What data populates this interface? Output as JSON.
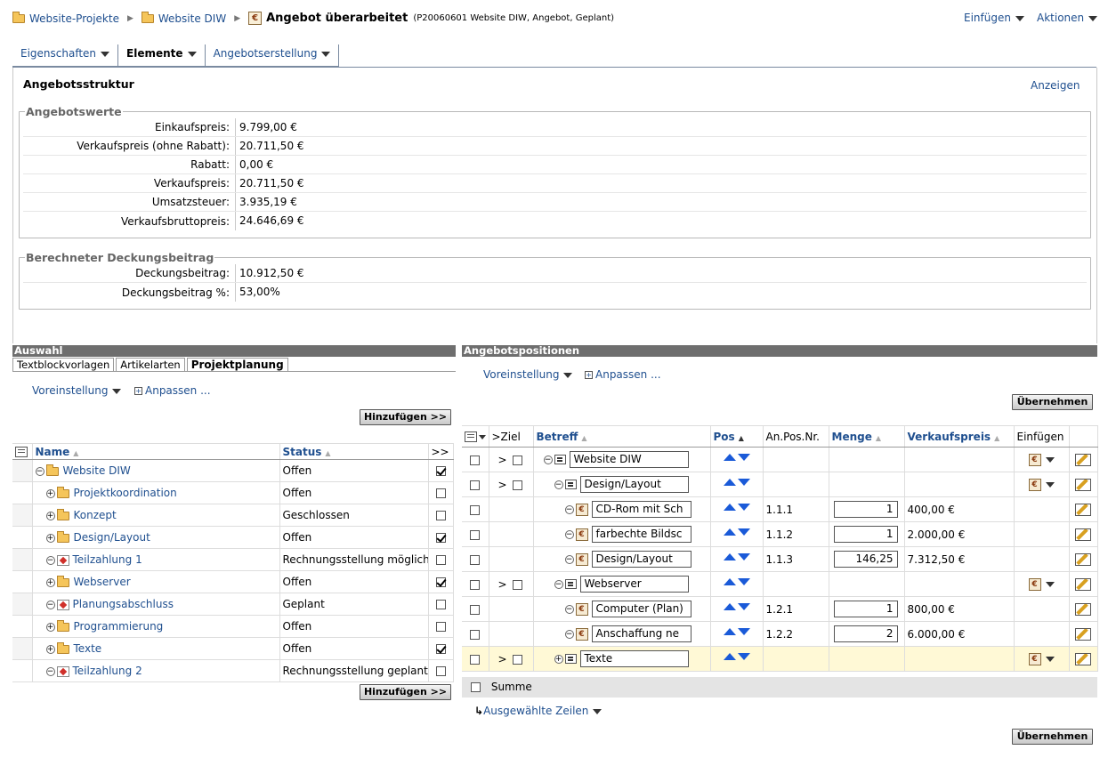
{
  "breadcrumb": {
    "items": [
      "Website-Projekte",
      "Website DIW"
    ],
    "current_title": "Angebot überarbeitet",
    "current_subtitle": "(P20060601 Website DIW, Angebot, Geplant)"
  },
  "top_menu": {
    "insert": "Einfügen",
    "actions": "Aktionen"
  },
  "tabs": [
    {
      "label": "Eigenschaften",
      "active": false
    },
    {
      "label": "Elemente",
      "active": true
    },
    {
      "label": "Angebotserstellung",
      "active": false
    }
  ],
  "structure": {
    "title": "Angebotsstruktur",
    "show_link": "Anzeigen"
  },
  "angebotswerte": {
    "legend": "Angebotswerte",
    "rows": [
      {
        "label": "Einkaufspreis:",
        "value": "9.799,00 €"
      },
      {
        "label": "Verkaufspreis (ohne Rabatt):",
        "value": "20.711,50 €"
      },
      {
        "label": "Rabatt:",
        "value": "0,00 €"
      },
      {
        "label": "Verkaufspreis:",
        "value": "20.711,50 €"
      },
      {
        "label": "Umsatzsteuer:",
        "value": "3.935,19 €"
      },
      {
        "label": "Verkaufsbruttopreis:",
        "value": "24.646,69 €"
      }
    ]
  },
  "deckungsbeitrag": {
    "legend": "Berechneter Deckungsbeitrag",
    "rows": [
      {
        "label": "Deckungsbeitrag:",
        "value": "10.912,50 €"
      },
      {
        "label": "Deckungsbeitrag %:",
        "value": "53,00%"
      }
    ]
  },
  "auswahl": {
    "header": "Auswahl",
    "subtabs": [
      "Textblockvorlagen",
      "Artikelarten",
      "Projektplanung"
    ],
    "preset": "Voreinstellung",
    "customize": "Anpassen ...",
    "add_button": "Hinzufügen >>",
    "columns": {
      "name": "Name",
      "status": "Status",
      "move": ">>"
    },
    "rows": [
      {
        "name": "Website DIW",
        "status": "Offen",
        "checked": true
      },
      {
        "name": "Projektkoordination",
        "status": "Offen",
        "checked": false
      },
      {
        "name": "Konzept",
        "status": "Geschlossen",
        "checked": false
      },
      {
        "name": "Design/Layout",
        "status": "Offen",
        "checked": true
      },
      {
        "name": "Teilzahlung 1",
        "status": "Rechnungsstellung möglich",
        "checked": false
      },
      {
        "name": "Webserver",
        "status": "Offen",
        "checked": true
      },
      {
        "name": "Planungsabschluss",
        "status": "Geplant",
        "checked": false
      },
      {
        "name": "Programmierung",
        "status": "Offen",
        "checked": false
      },
      {
        "name": "Texte",
        "status": "Offen",
        "checked": true
      },
      {
        "name": "Teilzahlung 2",
        "status": "Rechnungsstellung geplant",
        "checked": false
      }
    ]
  },
  "positionen": {
    "header": "Angebotspositionen",
    "preset": "Voreinstellung",
    "customize": "Anpassen ...",
    "apply_button": "Übernehmen",
    "columns": {
      "ziel": ">Ziel",
      "betreff": "Betreff",
      "pos": "Pos",
      "anpos": "An.Pos.Nr.",
      "menge": "Menge",
      "vk": "Verkaufspreis",
      "einfuegen": "Einfügen"
    },
    "ziel_marker": ">",
    "rows": [
      {
        "betreff": "Website DIW",
        "anpos": "",
        "menge": "",
        "vk": ""
      },
      {
        "betreff": "Design/Layout",
        "anpos": "",
        "menge": "",
        "vk": ""
      },
      {
        "betreff": "CD-Rom mit Sch",
        "anpos": "1.1.1",
        "menge": "1",
        "vk": "400,00 €"
      },
      {
        "betreff": "farbechte Bildsc",
        "anpos": "1.1.2",
        "menge": "1",
        "vk": "2.000,00 €"
      },
      {
        "betreff": "Design/Layout",
        "anpos": "1.1.3",
        "menge": "146,25",
        "vk": "7.312,50 €"
      },
      {
        "betreff": "Webserver",
        "anpos": "",
        "menge": "",
        "vk": ""
      },
      {
        "betreff": "Computer (Plan)",
        "anpos": "1.2.1",
        "menge": "1",
        "vk": "800,00 €"
      },
      {
        "betreff": "Anschaffung ne",
        "anpos": "1.2.2",
        "menge": "2",
        "vk": "6.000,00 €"
      },
      {
        "betreff": "Texte",
        "anpos": "",
        "menge": "",
        "vk": ""
      }
    ],
    "sum_label": "Summe",
    "selected_rows": "Ausgewählte Zeilen"
  }
}
